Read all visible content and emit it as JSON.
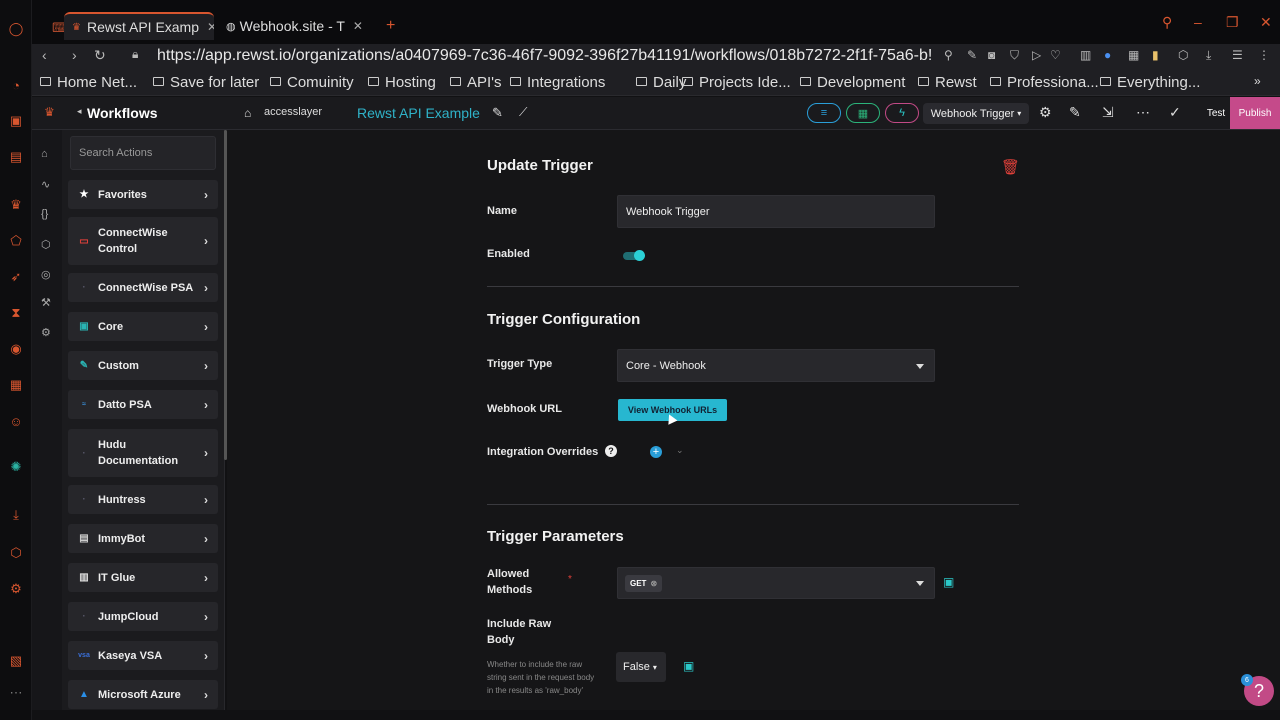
{
  "browser": {
    "tabs": [
      {
        "title": "Rewst API Examp",
        "active": true
      },
      {
        "title": "Webhook.site - T",
        "active": false
      }
    ],
    "url": "https://app.rewst.io/organizations/a0407969-7c36-46f7-9092-396f27b41191/workflows/018b7272-2f1f-75a6-b!",
    "bookmarks": [
      "Home Net...",
      "Save for later",
      "Comuinity",
      "Hosting",
      "API's",
      "Integrations",
      "Daily",
      "Projects Ide...",
      "Development",
      "Rewst",
      "Professiona...",
      "Everything..."
    ],
    "accent_color": "#d8562f"
  },
  "header": {
    "sidebar_title": "Workflows",
    "org": "accesslayer",
    "project": "Rewst API Example",
    "trigger_select": "Webhook Trigger",
    "test_label": "Test",
    "publish_label": "Publish"
  },
  "sidebar": {
    "search_placeholder": "Search Actions",
    "items": [
      {
        "label": "Favorites",
        "icon": "star-icon"
      },
      {
        "label": "ConnectWise Control",
        "icon": "connectwise-control-icon"
      },
      {
        "label": "ConnectWise PSA",
        "icon": "connectwise-psa-icon"
      },
      {
        "label": "Core",
        "icon": "core-icon"
      },
      {
        "label": "Custom",
        "icon": "custom-icon"
      },
      {
        "label": "Datto PSA",
        "icon": "datto-icon"
      },
      {
        "label": "Hudu Documentation",
        "icon": "hudu-icon"
      },
      {
        "label": "Huntress",
        "icon": "huntress-icon"
      },
      {
        "label": "ImmyBot",
        "icon": "immybot-icon"
      },
      {
        "label": "IT Glue",
        "icon": "itglue-icon"
      },
      {
        "label": "JumpCloud",
        "icon": "jumpcloud-icon"
      },
      {
        "label": "Kaseya VSA",
        "icon": "kaseya-icon"
      },
      {
        "label": "Microsoft Azure",
        "icon": "azure-icon"
      }
    ]
  },
  "form": {
    "update_title": "Update Trigger",
    "name_label": "Name",
    "name_value": "Webhook Trigger",
    "enabled_label": "Enabled",
    "enabled": true,
    "config_title": "Trigger Configuration",
    "trigger_type_label": "Trigger Type",
    "trigger_type_value": "Core - Webhook",
    "webhook_url_label": "Webhook URL",
    "view_urls_button": "View Webhook URLs",
    "overrides_label": "Integration Overrides",
    "params_title": "Trigger Parameters",
    "allowed_methods_label": "Allowed Methods",
    "allowed_methods_value": "GET",
    "raw_body_label": "Include Raw Body",
    "raw_body_hint": "Whether to include the raw string sent in the request body in the results as 'raw_body'",
    "raw_body_value": "False"
  },
  "help_badge": "6"
}
